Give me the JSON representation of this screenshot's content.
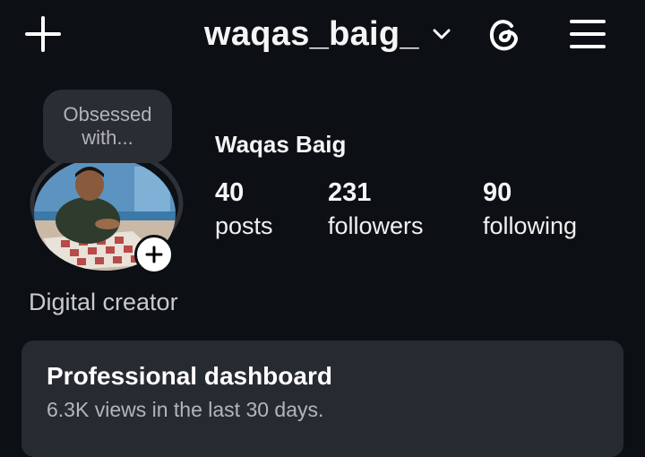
{
  "header": {
    "username": "waqas_baig_",
    "icons": [
      "plus-icon",
      "chevron-down-icon",
      "threads-icon",
      "menu-icon"
    ]
  },
  "profile": {
    "note": "Obsessed with...",
    "display_name": "Waqas Baig",
    "category": "Digital creator",
    "stats": [
      {
        "value": "40",
        "label": "posts"
      },
      {
        "value": "231",
        "label": "followers"
      },
      {
        "value": "90",
        "label": "following"
      }
    ]
  },
  "dashboard": {
    "title": "Professional dashboard",
    "subtitle": "6.3K views in the last 30 days."
  },
  "colors": {
    "background": "#0c0f14",
    "card": "#262a31",
    "note_bubble": "#2a2d33"
  }
}
